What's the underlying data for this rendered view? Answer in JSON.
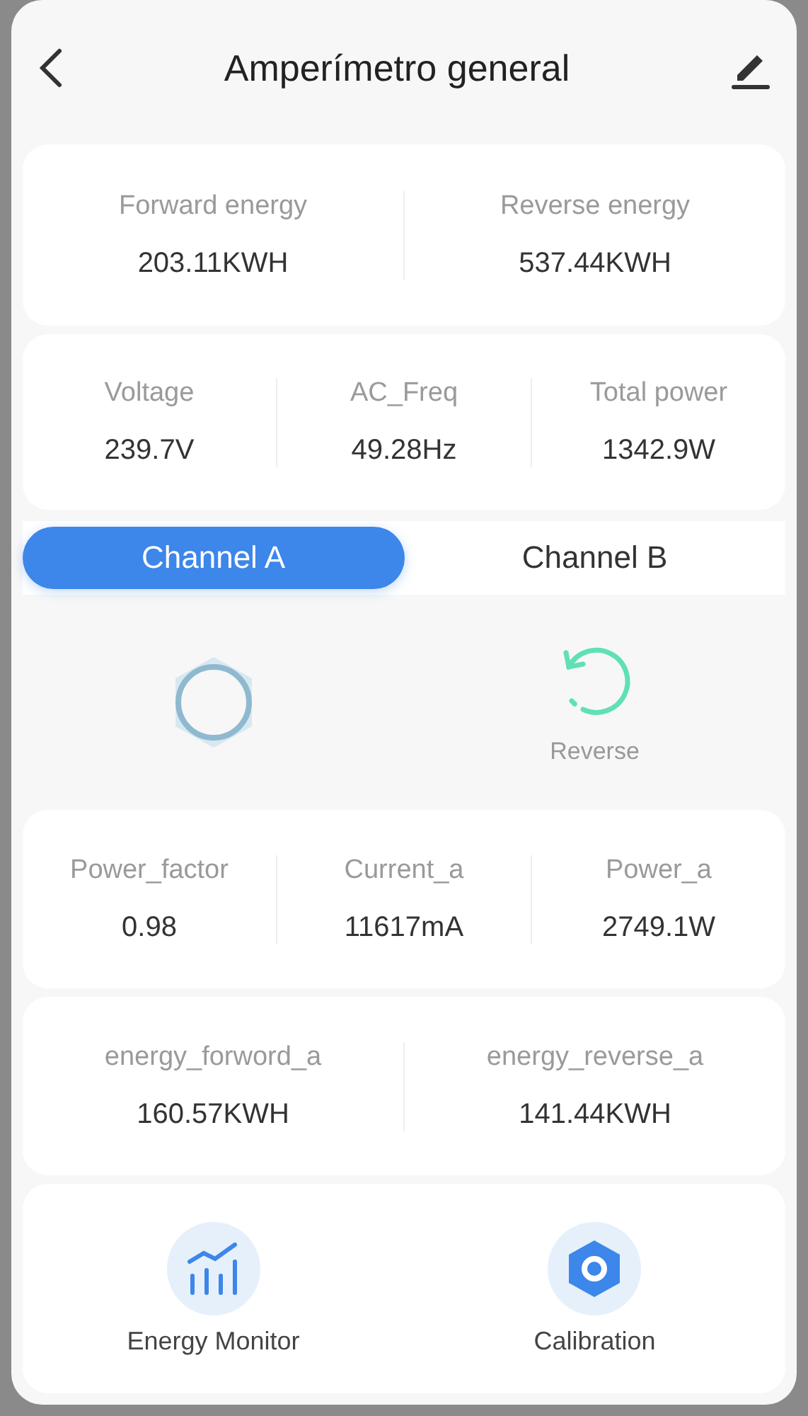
{
  "header": {
    "title": "Amperímetro general"
  },
  "cards": [
    {
      "stats": [
        {
          "label": "Forward energy",
          "value": "203.11KWH"
        },
        {
          "label": "Reverse energy",
          "value": "537.44KWH"
        }
      ]
    },
    {
      "stats": [
        {
          "label": "Voltage",
          "value": "239.7V"
        },
        {
          "label": "AC_Freq",
          "value": "49.28Hz"
        },
        {
          "label": "Total power",
          "value": "1342.9W"
        }
      ]
    }
  ],
  "tabs": [
    {
      "label": "Channel A",
      "selected": true
    },
    {
      "label": "Channel B",
      "selected": false
    }
  ],
  "status": {
    "reverse_label": "Reverse"
  },
  "channel_cards": [
    {
      "stats": [
        {
          "label": "Power_factor",
          "value": "0.98"
        },
        {
          "label": "Current_a",
          "value": "11617mA"
        },
        {
          "label": "Power_a",
          "value": "2749.1W"
        }
      ]
    },
    {
      "stats": [
        {
          "label": "energy_forword_a",
          "value": "160.57KWH"
        },
        {
          "label": "energy_reverse_a",
          "value": "141.44KWH"
        }
      ]
    }
  ],
  "actions": [
    {
      "kind": "chart",
      "label": "Energy Monitor"
    },
    {
      "kind": "calibration",
      "label": "Calibration"
    }
  ]
}
